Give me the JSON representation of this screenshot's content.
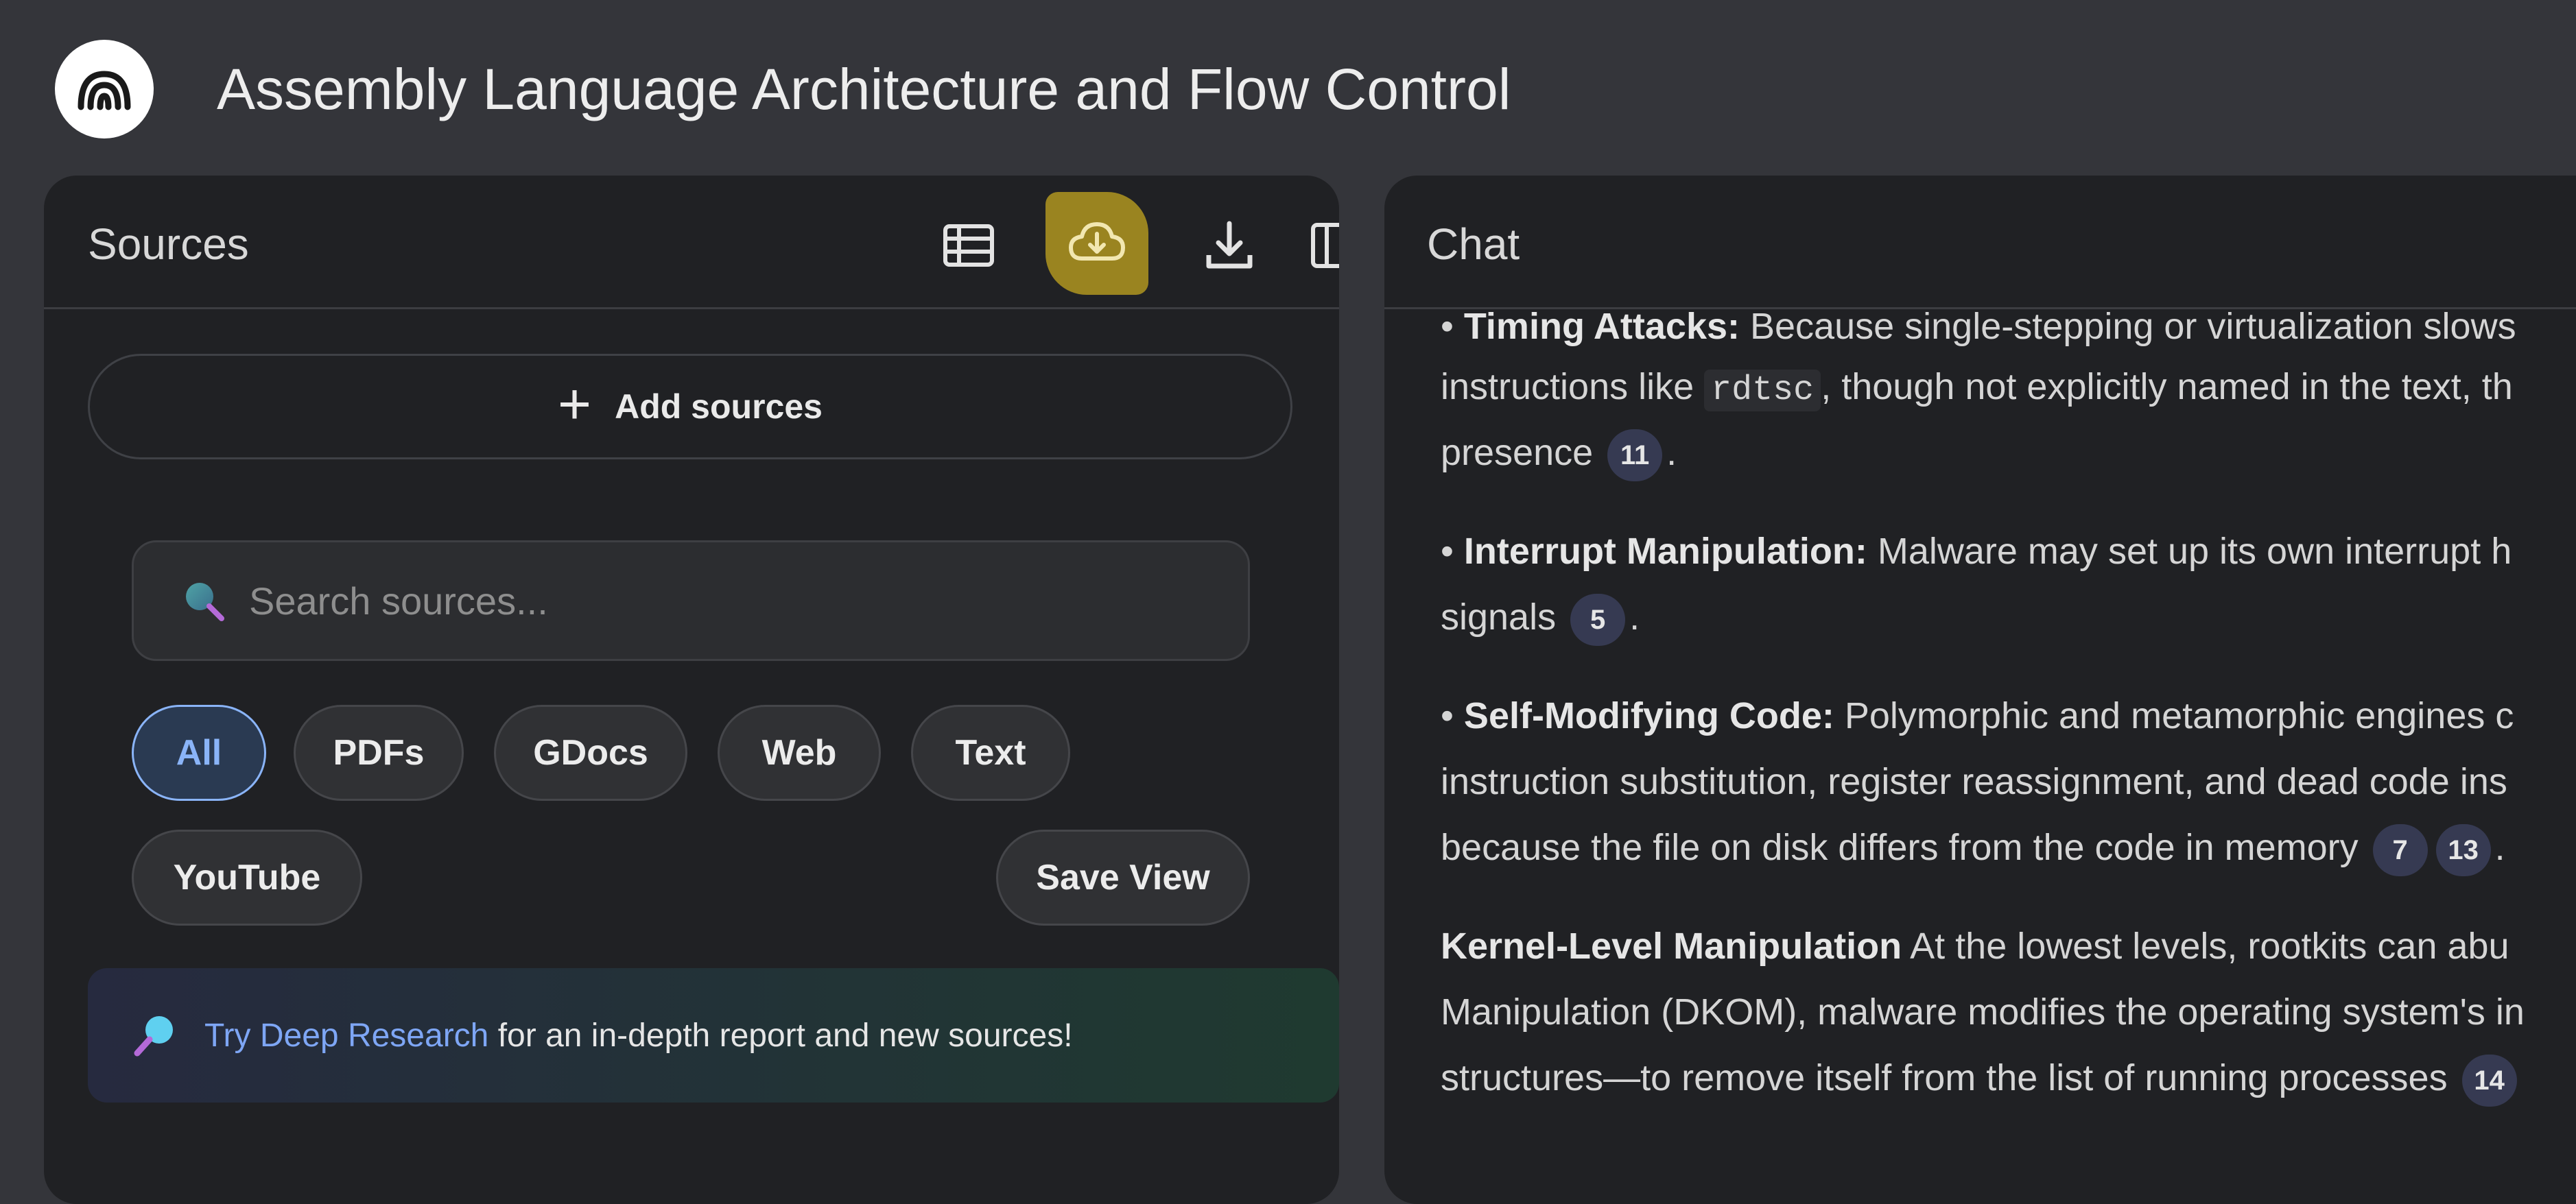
{
  "app": {
    "title": "Assembly Language Architecture and Flow Control"
  },
  "sources": {
    "title": "Sources",
    "add_label": "Add sources",
    "search_placeholder": "Search sources...",
    "filters": [
      "All",
      "PDFs",
      "GDocs",
      "Web",
      "Text",
      "YouTube"
    ],
    "save_view_label": "Save View",
    "research": {
      "link": "Try Deep Research",
      "rest": " for an in-depth report and new sources!"
    }
  },
  "chat": {
    "title": "Chat",
    "lines": [
      {
        "parts": [
          "• ",
          "Timing Attacks:",
          " Because single-stepping or virtualization slows"
        ]
      },
      {
        "parts": [
          "instructions like ",
          "rdtsc",
          ", though not explicitly named in the text, th"
        ]
      },
      {
        "parts": [
          "presence ",
          "11",
          "."
        ]
      },
      {
        "parts": [
          "• ",
          "Interrupt Manipulation:",
          " Malware may set up its own interrupt h"
        ]
      },
      {
        "parts": [
          "signals ",
          "5",
          "."
        ]
      },
      {
        "parts": [
          "• ",
          "Self-Modifying Code:",
          " Polymorphic and metamorphic engines c"
        ]
      },
      {
        "parts": [
          "instruction substitution, register reassignment, and dead code ins"
        ]
      },
      {
        "parts": [
          "because the file on disk differs from the code in memory ",
          "7",
          "13",
          "."
        ]
      },
      {
        "parts": [
          "Kernel-Level Manipulation",
          " At the lowest levels, rootkits can abu"
        ]
      },
      {
        "parts": [
          "Manipulation (DKOM), malware modifies the operating system's in"
        ]
      },
      {
        "parts": [
          "structures—to remove itself from the list of running processes ",
          "14"
        ]
      }
    ]
  },
  "colors": {
    "accent": "#8ab4f8",
    "highlight": "#9a8420",
    "panel": "#202124",
    "background": "#34353a"
  }
}
